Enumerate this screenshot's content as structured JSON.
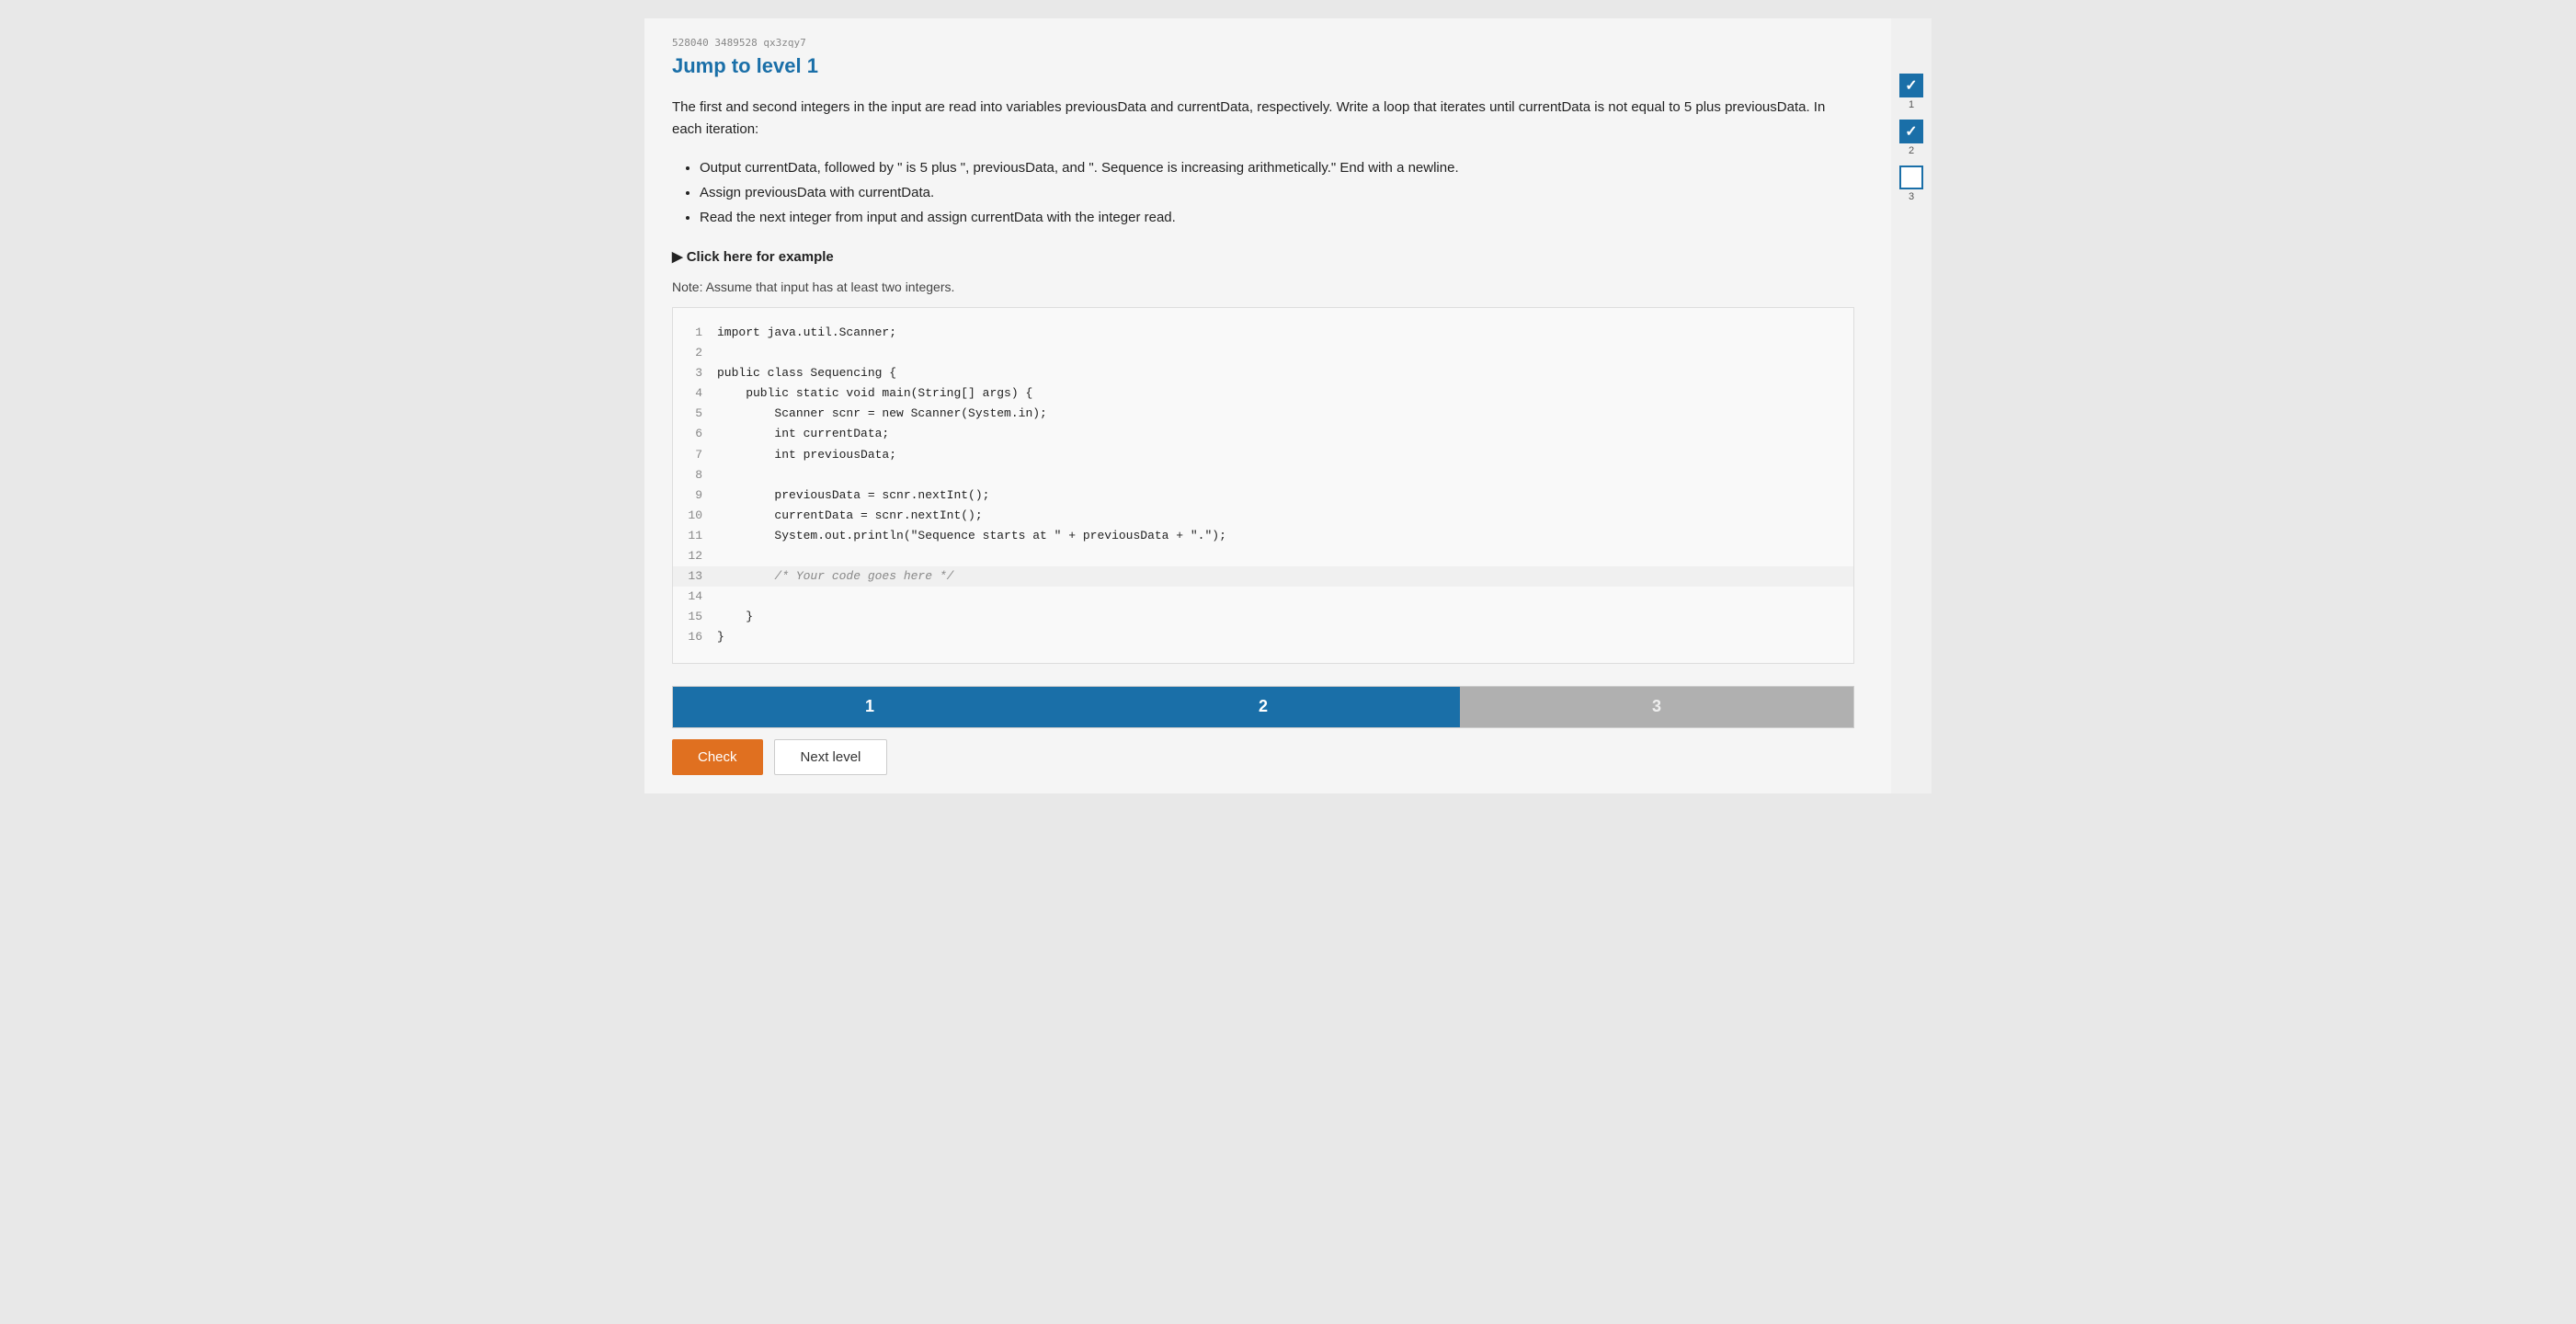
{
  "meta": {
    "id": "528040 3489528 qx3zqy7"
  },
  "header": {
    "jump_title": "Jump to level 1"
  },
  "description": {
    "paragraph": "The first and second integers in the input are read into variables previousData and currentData, respectively. Write a loop that iterates until currentData is not equal to 5 plus previousData. In each iteration:",
    "bullets": [
      "Output currentData, followed by \" is 5 plus \", previousData, and \". Sequence is increasing arithmetically.\" End with a newline.",
      "Assign previousData with currentData.",
      "Read the next integer from input and assign currentData with the integer read."
    ],
    "click_example": "Click here for example",
    "note": "Note: Assume that input has at least two integers."
  },
  "code": {
    "lines": [
      {
        "num": "1",
        "code": "import java.util.Scanner;",
        "highlighted": false
      },
      {
        "num": "2",
        "code": "",
        "highlighted": false
      },
      {
        "num": "3",
        "code": "public class Sequencing {",
        "highlighted": false
      },
      {
        "num": "4",
        "code": "    public static void main(String[] args) {",
        "highlighted": false
      },
      {
        "num": "5",
        "code": "        Scanner scnr = new Scanner(System.in);",
        "highlighted": false
      },
      {
        "num": "6",
        "code": "        int currentData;",
        "highlighted": false
      },
      {
        "num": "7",
        "code": "        int previousData;",
        "highlighted": false
      },
      {
        "num": "8",
        "code": "",
        "highlighted": false
      },
      {
        "num": "9",
        "code": "        previousData = scnr.nextInt();",
        "highlighted": false
      },
      {
        "num": "10",
        "code": "        currentData = scnr.nextInt();",
        "highlighted": false
      },
      {
        "num": "11",
        "code": "        System.out.println(\"Sequence starts at \" + previousData + \".\");",
        "highlighted": false
      },
      {
        "num": "12",
        "code": "",
        "highlighted": false
      },
      {
        "num": "13",
        "code": "        /* Your code goes here */",
        "highlighted": true,
        "is_comment": true
      },
      {
        "num": "14",
        "code": "",
        "highlighted": false
      },
      {
        "num": "15",
        "code": "    }",
        "highlighted": false
      },
      {
        "num": "16",
        "code": "}",
        "highlighted": false
      }
    ]
  },
  "tabs": [
    {
      "label": "1",
      "active": true
    },
    {
      "label": "2",
      "active": true
    },
    {
      "label": "3",
      "active": false
    }
  ],
  "buttons": {
    "check": "Check",
    "next": "Next level"
  },
  "sidebar": {
    "levels": [
      {
        "num": "1",
        "checked": true
      },
      {
        "num": "2",
        "checked": true
      },
      {
        "num": "3",
        "checked": false
      }
    ]
  }
}
